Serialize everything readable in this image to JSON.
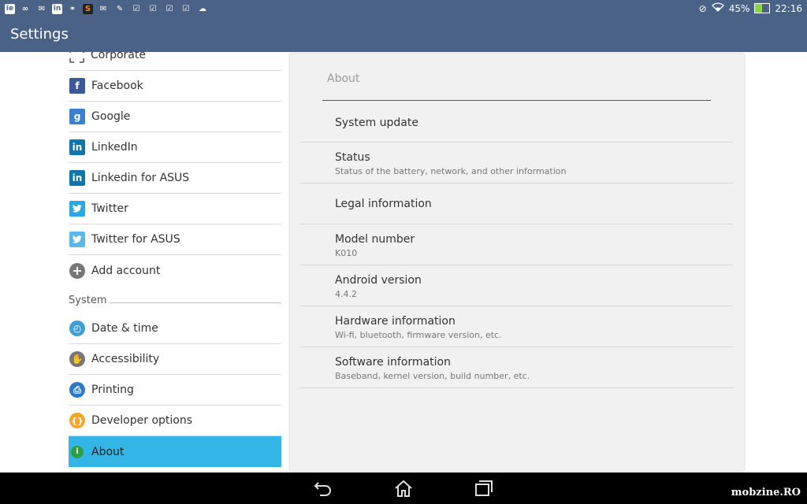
{
  "status_bar": {
    "notification_icons": [
      "ie-icon",
      "infinity-icon",
      "mail-icon",
      "linkedin-icon",
      "link-icon",
      "app-icon",
      "email-icon",
      "notes-icon",
      "check-icon",
      "check-icon",
      "check-icon",
      "check-icon",
      "cloud-icon"
    ],
    "battery": "45%",
    "battery_level": 0.45,
    "time": "22:16"
  },
  "app_bar": {
    "title": "Settings"
  },
  "accounts": [
    {
      "label": "Corporate",
      "icon": "corporate-icon",
      "color": "#555555"
    },
    {
      "label": "Facebook",
      "icon": "facebook-icon",
      "color": "#3b5998"
    },
    {
      "label": "Google",
      "icon": "google-icon",
      "color": "#3f7fcf"
    },
    {
      "label": "LinkedIn",
      "icon": "linkedin-icon",
      "color": "#0e76a8"
    },
    {
      "label": "Linkedin for ASUS",
      "icon": "linkedin-icon",
      "color": "#0e76a8"
    },
    {
      "label": "Twitter",
      "icon": "twitter-icon",
      "color": "#2aa9e0"
    },
    {
      "label": "Twitter for ASUS",
      "icon": "twitter-icon",
      "color": "#2aa9e0"
    },
    {
      "label": "Add account",
      "icon": "add-icon",
      "color": "#777777"
    }
  ],
  "system": {
    "header": "System",
    "items": [
      {
        "label": "Date & time",
        "icon": "clock-icon",
        "color": "#3d9fd5"
      },
      {
        "label": "Accessibility",
        "icon": "hand-icon",
        "color": "#777777"
      },
      {
        "label": "Printing",
        "icon": "printer-icon",
        "color": "#2d78c8"
      },
      {
        "label": "Developer options",
        "icon": "braces-icon",
        "color": "#f2a623"
      },
      {
        "label": "About",
        "icon": "info-icon",
        "color": "#2e9e46",
        "selected": true
      }
    ]
  },
  "about": {
    "title": "About",
    "items": [
      {
        "title": "System update",
        "summary": ""
      },
      {
        "title": "Status",
        "summary": "Status of the battery, network, and other information"
      },
      {
        "title": "Legal information",
        "summary": ""
      },
      {
        "title": "Model number",
        "summary": "K010"
      },
      {
        "title": "Android version",
        "summary": "4.4.2"
      },
      {
        "title": "Hardware information",
        "summary": "Wi-fi, bluetooth, firmware version, etc."
      },
      {
        "title": "Software information",
        "summary": "Baseband, kernel version, build number, etc."
      }
    ]
  },
  "nav_bar": {
    "buttons": [
      "back-icon",
      "home-icon",
      "recents-icon"
    ]
  },
  "watermark": "mobzine.RO",
  "colors": {
    "bar": "#4a6285",
    "selected": "#33b5e5",
    "pane": "#f1f1f1"
  }
}
